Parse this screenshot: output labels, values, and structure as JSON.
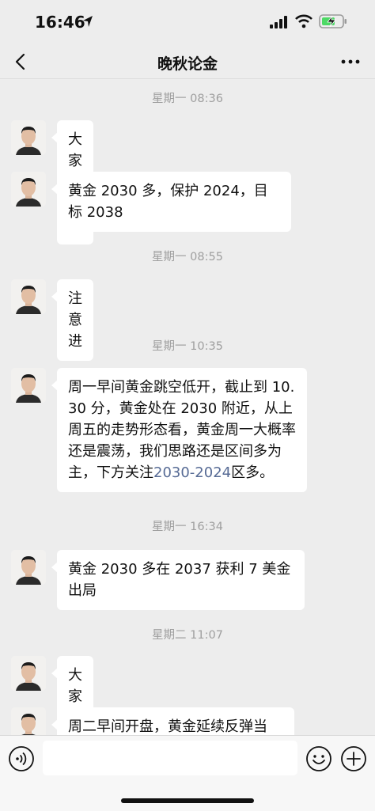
{
  "status": {
    "time": "16:46",
    "icons": [
      "location-arrow-icon",
      "signal-icon",
      "wifi-icon",
      "battery-charging-icon"
    ]
  },
  "nav": {
    "title": "晚秋论金",
    "back_icon": "chevron-left-icon",
    "more_icon": "more-dots-icon"
  },
  "messages": [
    {
      "timestamp": "星期一 08:36",
      "text": "大家上午好"
    },
    {
      "timestamp": "",
      "text": "黄金 2030 多，保护 2024，目标 2038"
    },
    {
      "timestamp": "星期一 08:55",
      "text": "注意进"
    },
    {
      "timestamp": "星期一 10:35",
      "text_before": "周一早间黄金跳空低开，截止到 10.30 分，黄金处在 2030 附近，从上周五的走势形态看，黄金周一大概率还是震荡，我们思路还是区间多为主，下方关注",
      "link": "2030-2024",
      "text_after": "区多。"
    },
    {
      "timestamp": "星期一 16:34",
      "text": "黄金 2030 多在 2037 获利 7 美金出局"
    },
    {
      "timestamp": "星期二 11:07",
      "text": "大家上午好"
    },
    {
      "timestamp": "",
      "text": "周二早间开盘，黄金延续反弹当"
    }
  ],
  "input_bar": {
    "icons": [
      "voice-icon",
      "emoji-icon",
      "plus-icon"
    ],
    "placeholder": ""
  },
  "colors": {
    "background": "#ededed",
    "bubble": "#ffffff",
    "link": "#576b95",
    "timestamp": "#9f9f9f"
  }
}
